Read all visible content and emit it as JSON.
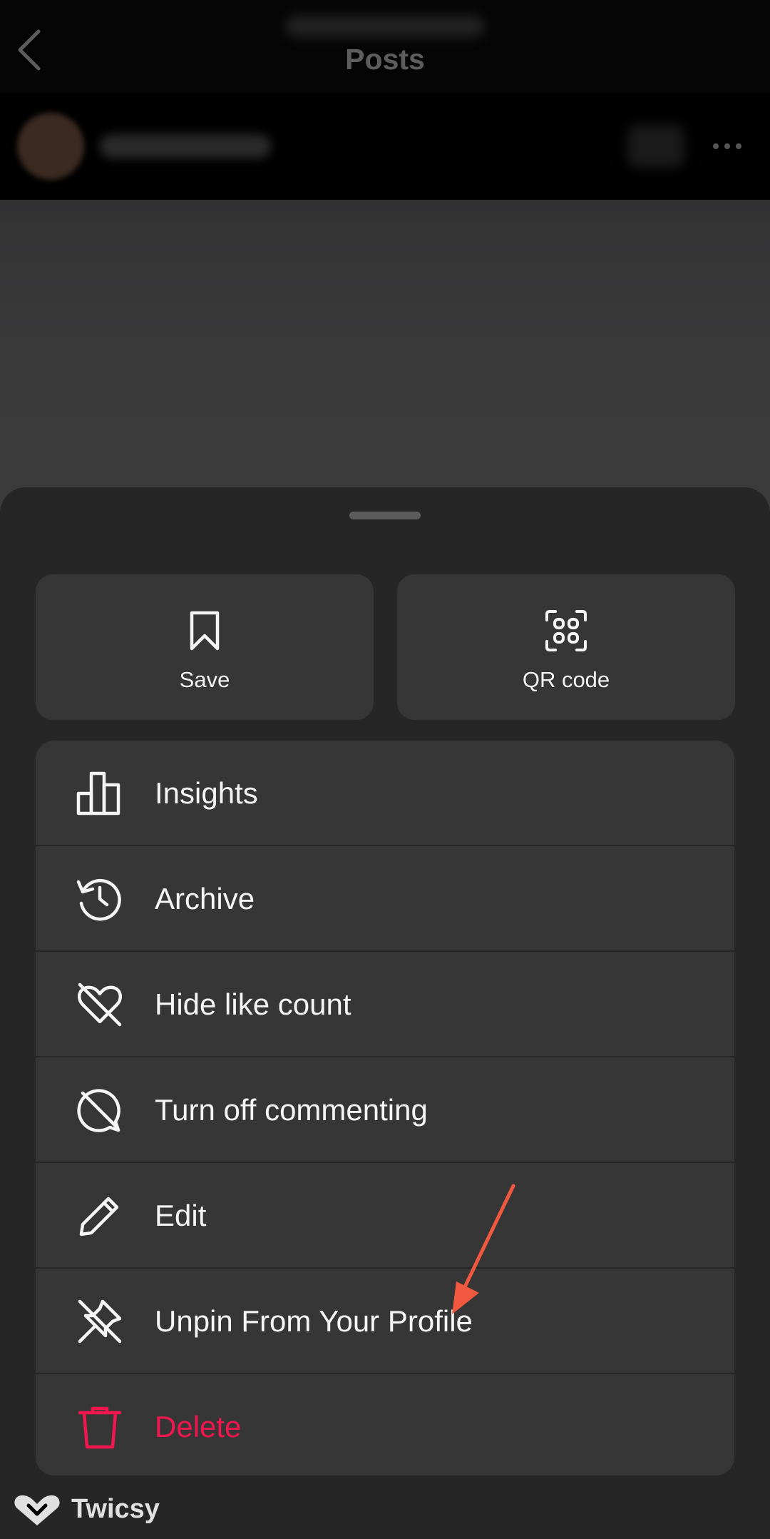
{
  "header": {
    "title": "Posts",
    "back_icon": "chevron-left-icon",
    "more_icon": "more-horizontal-icon"
  },
  "sheet": {
    "tiles": [
      {
        "label": "Save",
        "icon": "bookmark-icon"
      },
      {
        "label": "QR code",
        "icon": "qr-code-icon"
      }
    ],
    "menu": [
      {
        "label": "Insights",
        "icon": "bar-chart-icon"
      },
      {
        "label": "Archive",
        "icon": "archive-history-icon"
      },
      {
        "label": "Hide like count",
        "icon": "heart-off-icon"
      },
      {
        "label": "Turn off commenting",
        "icon": "comment-off-icon"
      },
      {
        "label": "Edit",
        "icon": "pencil-icon"
      },
      {
        "label": "Unpin From Your Profile",
        "icon": "unpin-icon"
      },
      {
        "label": "Delete",
        "icon": "trash-icon"
      }
    ]
  },
  "annotation": {
    "icon": "arrow-annotation-icon",
    "color": "#f0583f"
  },
  "watermark": {
    "text": "Twicsy"
  },
  "colors": {
    "sheet_bg": "#262626",
    "item_bg": "#363636",
    "danger": "#f0164e"
  }
}
